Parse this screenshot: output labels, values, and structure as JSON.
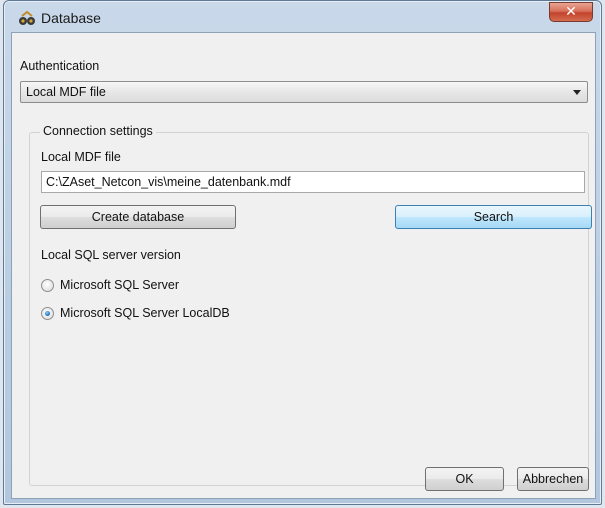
{
  "window": {
    "title": "Database",
    "close_label": "✕"
  },
  "authentication": {
    "label": "Authentication",
    "selected": "Local MDF file"
  },
  "connection_settings": {
    "group_title": "Connection settings",
    "mdf_label": "Local MDF file",
    "mdf_path": "C:\\ZAset_Netcon_vis\\meine_datenbank.mdf",
    "create_button": "Create database",
    "search_button": "Search",
    "sql_version_label": "Local SQL server version",
    "options": [
      {
        "label": "Microsoft SQL Server",
        "selected": false
      },
      {
        "label": "Microsoft SQL Server LocalDB",
        "selected": true
      }
    ]
  },
  "footer": {
    "ok_button": "OK",
    "cancel_button": "Abbrechen"
  },
  "colors": {
    "accent_focus": "#3c7fb1",
    "radio_selected": "#1b67b3",
    "close_button": "#c2432b"
  }
}
